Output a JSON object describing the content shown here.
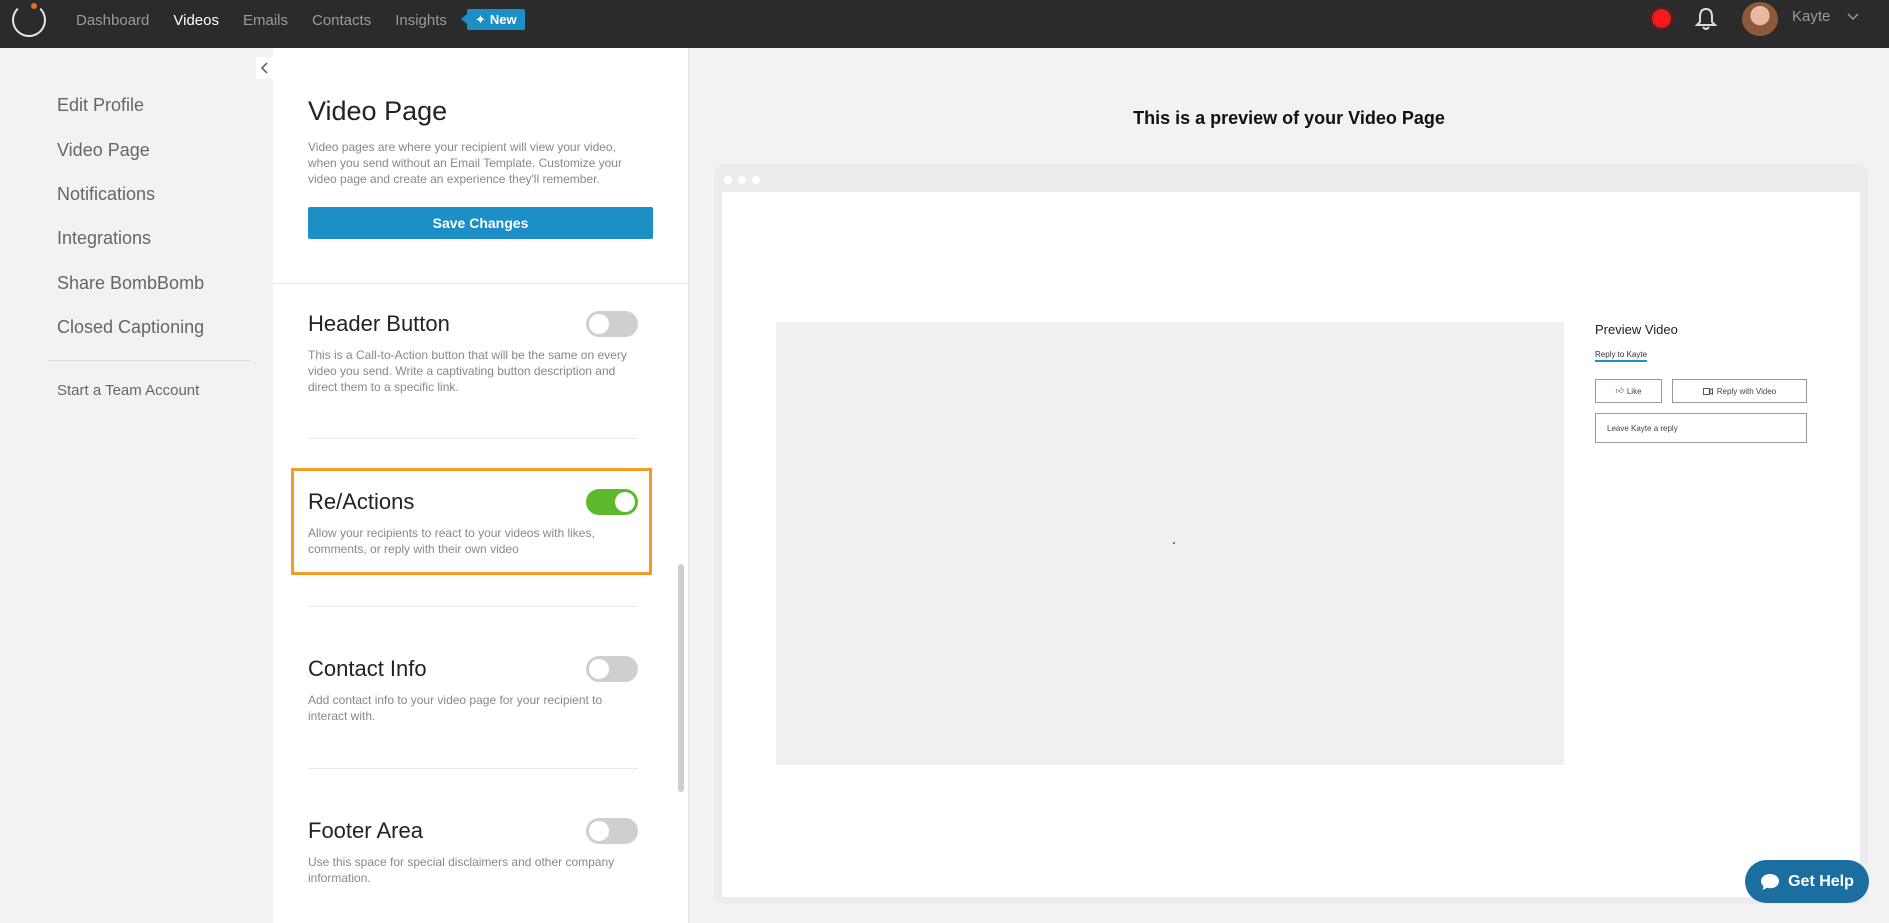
{
  "topnav": {
    "items": [
      "Dashboard",
      "Videos",
      "Emails",
      "Contacts",
      "Insights"
    ],
    "active": "Videos",
    "new_badge": "New",
    "user_name": "Kayte"
  },
  "settings_nav": {
    "items": [
      "Edit Profile",
      "Video Page",
      "Notifications",
      "Integrations",
      "Share BombBomb",
      "Closed Captioning"
    ],
    "team_link": "Start a Team Account"
  },
  "video_page": {
    "title": "Video Page",
    "description": "Video pages are where your recipient will view your video, when you send without an Email Template. Customize your video page and create an experience they'll remember.",
    "save_label": "Save Changes"
  },
  "sections": [
    {
      "title": "Header Button",
      "description": "This is a Call-to-Action button that will be the same on every video you send. Write a captivating button description and direct them to a specific link.",
      "enabled": false
    },
    {
      "title": "Re/Actions",
      "description": "Allow your recipients to react to your videos with likes, comments, or reply with their own video",
      "enabled": true
    },
    {
      "title": "Contact Info",
      "description": "Add contact info to your video page for your recipient to interact with.",
      "enabled": false
    },
    {
      "title": "Footer Area",
      "description": "Use this space for special disclaimers and other company information.",
      "enabled": false
    }
  ],
  "preview": {
    "heading": "This is a preview of your Video Page",
    "video_title": "Preview Video",
    "reply_link": "Reply to Kayte",
    "like_label": "Like",
    "reply_video_label": "Reply with Video",
    "reply_placeholder": "Leave Kayte a reply"
  },
  "help": {
    "label": "Get Help"
  },
  "colors": {
    "accent": "#1b8fc6",
    "toggle_on": "#5db82c",
    "highlight": "#f39b27"
  }
}
